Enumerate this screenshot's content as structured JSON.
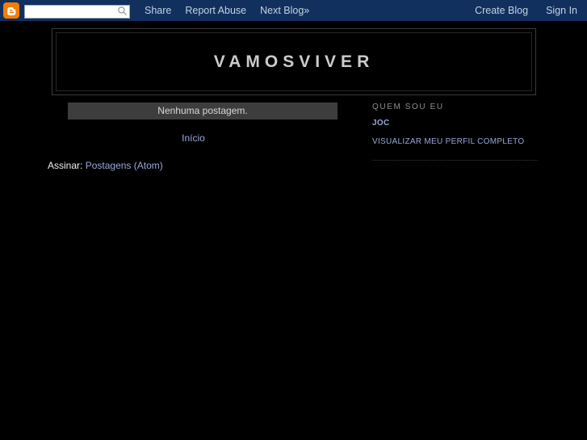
{
  "navbar": {
    "logo_icon": "blogger-b-icon",
    "search": {
      "value": "",
      "placeholder": "",
      "icon": "search-icon"
    },
    "links_left": [
      {
        "label": "Share"
      },
      {
        "label": "Report Abuse"
      },
      {
        "label": "Next Blog»"
      }
    ],
    "links_right": [
      {
        "label": "Create Blog"
      },
      {
        "label": "Sign In"
      }
    ]
  },
  "header": {
    "title": "VAMOSVIVER"
  },
  "main": {
    "status_message": "Nenhuma postagem.",
    "pager": {
      "home_label": "Início"
    },
    "feed": {
      "label": "Assinar:",
      "link_label": "Postagens (Atom)"
    }
  },
  "sidebar": {
    "profile_widget": {
      "heading": "QUEM SOU EU",
      "display_name": "JOC",
      "view_profile_label": "VISUALIZAR MEU PERFIL COMPLETO"
    }
  },
  "colors": {
    "navbar_background": "#11305e",
    "page_background": "#000000",
    "link": "#9aa8d8",
    "navbar_link": "#c3d2e4",
    "status_bar": "#3d3d3d",
    "title_text": "#cccccc",
    "sidebar_heading": "#8e8e8e",
    "logo_orange": "#f57d00"
  }
}
